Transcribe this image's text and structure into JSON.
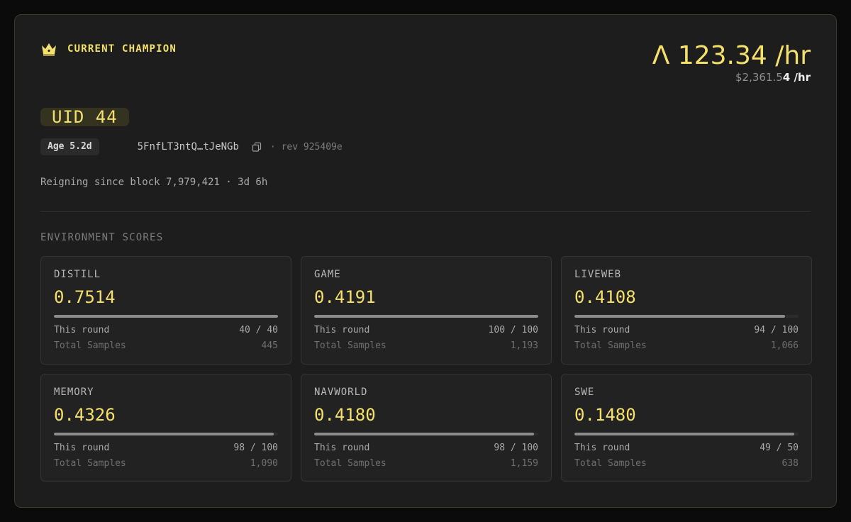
{
  "champion": {
    "label": "CURRENT CHAMPION",
    "rate": "Λ 123.34 /hr",
    "usd_dim": "$2,361.5",
    "usd_bright": "4 /hr",
    "uid": "UID 44",
    "age": "Age 5.2d",
    "hotkey": "5FnfLT3ntQ…tJeNGb",
    "rev": "· rev 925409e",
    "reign": "Reigning since block 7,979,421 · 3d 6h"
  },
  "icons": {
    "crown": "crown-icon",
    "copy": "copy-icon"
  },
  "colors": {
    "accent": "#f5e06a",
    "card_bg": "#1d1d1d"
  },
  "environment": {
    "title": "ENVIRONMENT SCORES",
    "round_label": "This round",
    "total_label": "Total Samples",
    "items": [
      {
        "name": "DISTILL",
        "score": "0.7514",
        "round": "40 / 40",
        "progress": 1.0,
        "total": "445"
      },
      {
        "name": "GAME",
        "score": "0.4191",
        "round": "100 / 100",
        "progress": 1.0,
        "total": "1,193"
      },
      {
        "name": "LIVEWEB",
        "score": "0.4108",
        "round": "94 / 100",
        "progress": 0.94,
        "total": "1,066"
      },
      {
        "name": "MEMORY",
        "score": "0.4326",
        "round": "98 / 100",
        "progress": 0.98,
        "total": "1,090"
      },
      {
        "name": "NAVWORLD",
        "score": "0.4180",
        "round": "98 / 100",
        "progress": 0.98,
        "total": "1,159"
      },
      {
        "name": "SWE",
        "score": "0.1480",
        "round": "49 / 50",
        "progress": 0.98,
        "total": "638"
      }
    ]
  }
}
